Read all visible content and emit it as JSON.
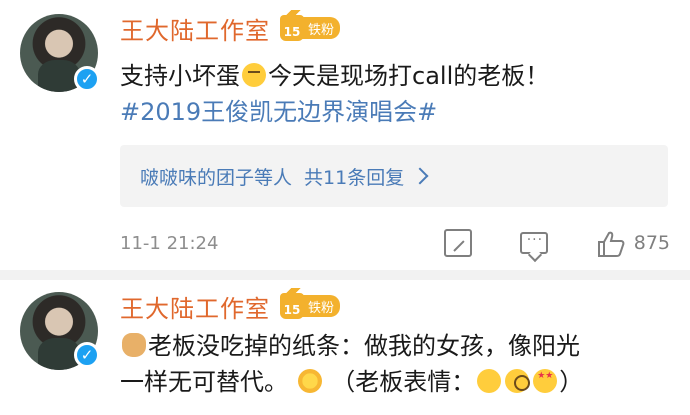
{
  "comments": [
    {
      "username": "王大陆工作室",
      "fan_badge": {
        "level": "15",
        "label": "铁粉"
      },
      "content": {
        "part1": "支持小坏蛋",
        "part2": "今天是现场打call的老板！",
        "hashtag": "#2019王俊凯无边界演唱会#"
      },
      "reply_summary": {
        "names": "啵啵味的团子等人",
        "count_text": "共11条回复"
      },
      "timestamp": "11-1 21:24",
      "like_count": "875"
    },
    {
      "username": "王大陆工作室",
      "fan_badge": {
        "level": "15",
        "label": "铁粉"
      },
      "content": {
        "line1": "老板没吃掉的纸条：做我的女孩，像阳光",
        "line2a": "一样无可替代。",
        "line2b": "（老板表情：",
        "line2c": "）"
      }
    }
  ],
  "icons": {
    "verified": "verified-icon",
    "share": "share-icon",
    "comment": "comment-icon",
    "like": "like-icon",
    "chevron": "chevron-right-icon"
  },
  "colors": {
    "username": "#e0682d",
    "badge": "#f3b12d",
    "link": "#4a7bb7",
    "verified": "#1da1f2",
    "muted": "#8e8e8e"
  }
}
